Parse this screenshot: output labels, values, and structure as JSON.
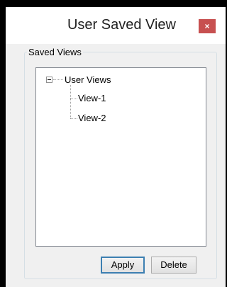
{
  "window": {
    "title": "User Saved View",
    "close_label": "×"
  },
  "group": {
    "label": "Saved Views"
  },
  "tree": {
    "root": {
      "label": "User Views",
      "expanded": true
    },
    "children": [
      {
        "label": "View-1"
      },
      {
        "label": "View-2"
      }
    ]
  },
  "buttons": {
    "apply": "Apply",
    "delete": "Delete"
  }
}
